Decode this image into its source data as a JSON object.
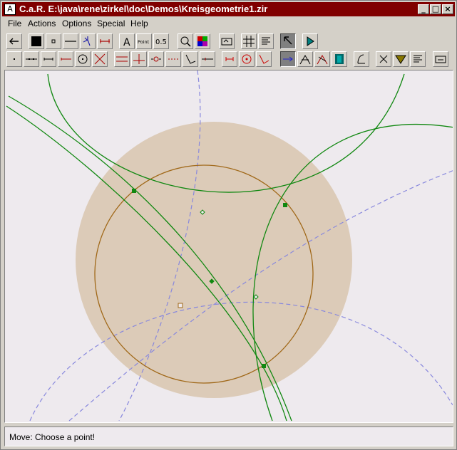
{
  "window": {
    "title": "C.a.R. E:\\java\\rene\\zirkel\\doc\\Demos\\Kreisgeometrie1.zir"
  },
  "menu": [
    "File",
    "Actions",
    "Options",
    "Special",
    "Help"
  ],
  "toolbar1": {
    "point_label": "Point",
    "decimal_label": "0.5",
    "text_label": "A"
  },
  "status": {
    "text": "Move: Choose a point!"
  },
  "colors": {
    "title_bar": "#800000",
    "canvas_bg": "#eeeaee",
    "disk_fill": "#dccbb8",
    "circle_brown": "#a06818",
    "green": "#118811",
    "dashed_blue": "#8888dd"
  }
}
